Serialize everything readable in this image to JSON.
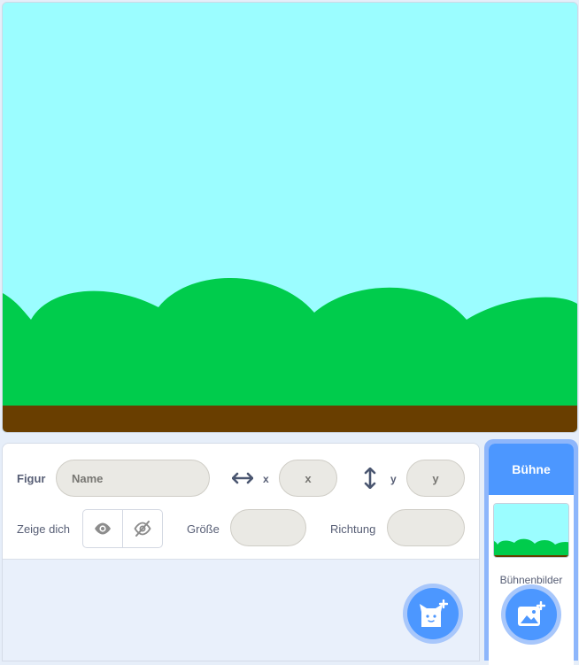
{
  "stage_panel": {
    "title": "Bühne",
    "backdrops_label": "Bühnenbilder"
  },
  "sprite_info": {
    "sprite_label": "Figur",
    "name_placeholder": "Name",
    "x_label": "x",
    "x_placeholder": "x",
    "y_label": "y",
    "y_placeholder": "y",
    "show_label": "Zeige dich",
    "size_label": "Größe",
    "direction_label": "Richtung"
  },
  "icons": {
    "x_arrow": "horizontal-arrows-icon",
    "y_arrow": "vertical-arrows-icon",
    "show": "eye-icon",
    "hide": "eye-slash-icon",
    "add_sprite": "cat-plus-icon",
    "add_backdrop": "image-plus-icon"
  },
  "colors": {
    "sky": "#9bfdff",
    "hills": "#00cc4c",
    "ground": "#693e00",
    "accent": "#4c97ff"
  }
}
